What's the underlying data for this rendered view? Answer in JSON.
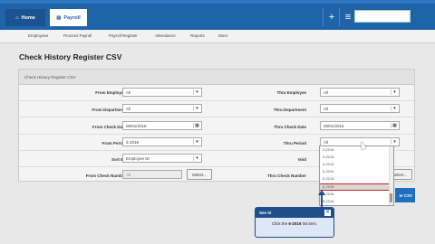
{
  "topbar": {
    "tabs": [
      {
        "label": "Home",
        "icon": "home-icon"
      },
      {
        "label": "Payroll",
        "icon": "payroll-icon"
      }
    ],
    "add_icon": "plus-icon",
    "menu_icon": "hamburger-icon",
    "search_placeholder": ""
  },
  "nav": {
    "items": [
      "Employees",
      "Process Payroll",
      "Payroll Register",
      "Attendance",
      "Reports",
      "More"
    ]
  },
  "page": {
    "title": "Check History Register CSV"
  },
  "form": {
    "panel_title": "Check History Register CSV",
    "from_employee": {
      "label": "From Employee",
      "value": "All"
    },
    "thru_employee": {
      "label": "Thru Employee",
      "value": "All"
    },
    "from_department": {
      "label": "From Department",
      "value": "All"
    },
    "thru_department": {
      "label": "Thru Department",
      "value": "All"
    },
    "from_check_date": {
      "label": "From Check Date",
      "value": "06/01/2016"
    },
    "thru_check_date": {
      "label": "Thru Check Date",
      "value": "06/01/2016"
    },
    "from_period": {
      "label": "From Period",
      "value": "6-2016"
    },
    "thru_period": {
      "label": "Thru Period",
      "value": "All"
    },
    "sort_by": {
      "label": "Sort By",
      "value": "Employee ID"
    },
    "void": {
      "label": "Void",
      "value": "All"
    },
    "from_check_number": {
      "label": "From Check Number",
      "value": "All",
      "button": "Select..."
    },
    "thru_check_number": {
      "label": "Thru Check Number",
      "button": "Select..."
    }
  },
  "dropdown": {
    "items": [
      "2-2016",
      "3-2016",
      "4-2016",
      "5-2016",
      "6-2016",
      "7-2016",
      "8-2016",
      "9-2016",
      "10-2016",
      "11-2016",
      "12-2016",
      "1-2017"
    ],
    "highlighted": "6-2016"
  },
  "actions": {
    "csv_label": "te CSV"
  },
  "callout": {
    "title": "See it!",
    "text_prefix": "Click the ",
    "text_bold": "6-2016",
    "text_suffix": " list item."
  },
  "colors": {
    "brand_blue": "#1f63a8",
    "highlight_red": "#c81d1d"
  }
}
